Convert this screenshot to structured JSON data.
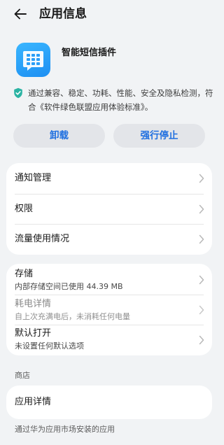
{
  "header": {
    "title": "应用信息",
    "back_icon": "arrow-left-icon"
  },
  "app": {
    "name": "智能短信插件",
    "icon": "chat-bubble-grid-icon"
  },
  "security": {
    "icon": "shield-check-icon",
    "text": "通过兼容、稳定、功耗、性能、安全及隐私检测，符合《软件绿色联盟应用体验标准》。"
  },
  "actions": {
    "uninstall_label": "卸载",
    "force_stop_label": "强行停止"
  },
  "card1": {
    "items": [
      {
        "label": "通知管理"
      },
      {
        "label": "权限"
      },
      {
        "label": "流量使用情况"
      }
    ]
  },
  "card2": {
    "items": [
      {
        "label": "存储",
        "sub": "内部存储空间已使用 44.39 MB"
      },
      {
        "label": "耗电详情",
        "sub": "自上次充满电后，未消耗任何电量",
        "disabled": true
      },
      {
        "label": "默认打开",
        "sub": "未设置任何默认选项"
      }
    ]
  },
  "store": {
    "section_title": "商店",
    "item_label": "应用详情",
    "footer": "通过华为应用市场安装的应用"
  },
  "colors": {
    "background": "#f1f3f5",
    "accent": "#1f6fe0",
    "card": "#ffffff",
    "app_icon": "#2a9ef7"
  }
}
